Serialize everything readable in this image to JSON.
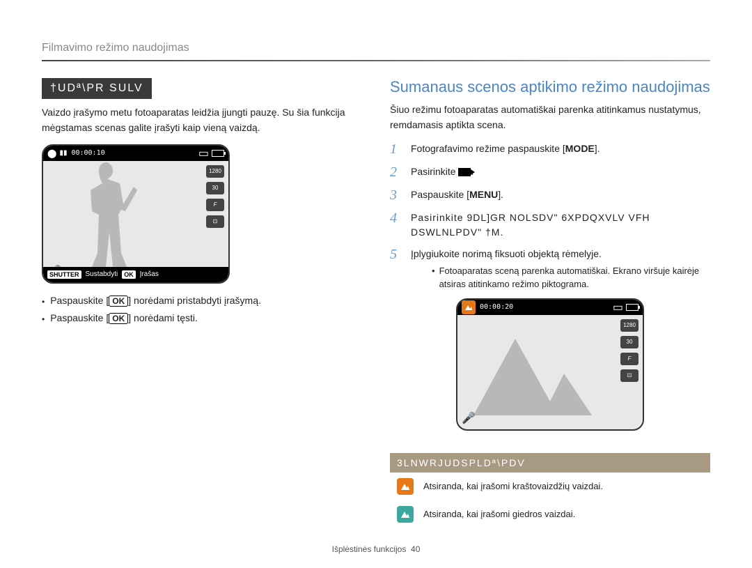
{
  "header": {
    "breadcrumb": "Filmavimo režimo naudojimas"
  },
  "left": {
    "ribbon": "†UDª\\PR SULV",
    "intro": "Vaizdo įrašymo metu fotoaparatas leidžia įjungti pauzę. Su šia funkcija mėgstamas scenas galite įrašyti kaip vieną vaizdą.",
    "preview": {
      "timer": "00:00:10",
      "icons": [
        "1280",
        "30",
        "F",
        "⊡"
      ],
      "shutter_label": "SHUTTER",
      "shutter_text": "Sustabdyti",
      "ok_label": "OK",
      "ok_text": "Įrašas"
    },
    "bullets": [
      "Paspauskite [OK] norėdami pristabdyti įrašymą.",
      "Paspauskite [OK] norėdami tęsti."
    ]
  },
  "right": {
    "title": "Sumanaus scenos aptikimo režimo naudojimas",
    "intro": "Šiuo režimu fotoaparatas automatiškai parenka atitinkamus nustatymus, remdamasis aptikta scena.",
    "steps": [
      {
        "n": "1",
        "text_pre": "Fotografavimo režime paspauskite [",
        "key": "MODE",
        "text_post": "]."
      },
      {
        "n": "2",
        "text_pre": "Pasirinkite ",
        "icon": "video",
        "text_post": "."
      },
      {
        "n": "3",
        "text_pre": "Paspauskite [",
        "key": "MENU",
        "text_post": "]."
      },
      {
        "n": "4",
        "text": "Pasirinkite 9DL]GR NOLSDV\" 6XPDQXVLV VFH DSWLNLPDV\" †M."
      },
      {
        "n": "5",
        "text": "Įplygiukoite norimą fiksuoti objektą rėmelyje.",
        "sub": "Fotoaparatas sceną parenka automatiškai. Ekrano viršuje kairėje atsiras atitinkamo režimo piktograma."
      }
    ],
    "preview2": {
      "timer": "00:00:20",
      "icons": [
        "1280",
        "30",
        "F",
        "⊡"
      ]
    },
    "table": {
      "header": "3LNWRJUDSPLDª\\PDV",
      "rows": [
        {
          "color": "orange",
          "text": "Atsiranda, kai įrašomi kraštovaizdžių vaizdai."
        },
        {
          "color": "teal",
          "text": "Atsiranda, kai įrašomi giedros vaizdai."
        }
      ]
    }
  },
  "footer": {
    "text": "Išplėstinės funkcijos",
    "page": "40"
  }
}
